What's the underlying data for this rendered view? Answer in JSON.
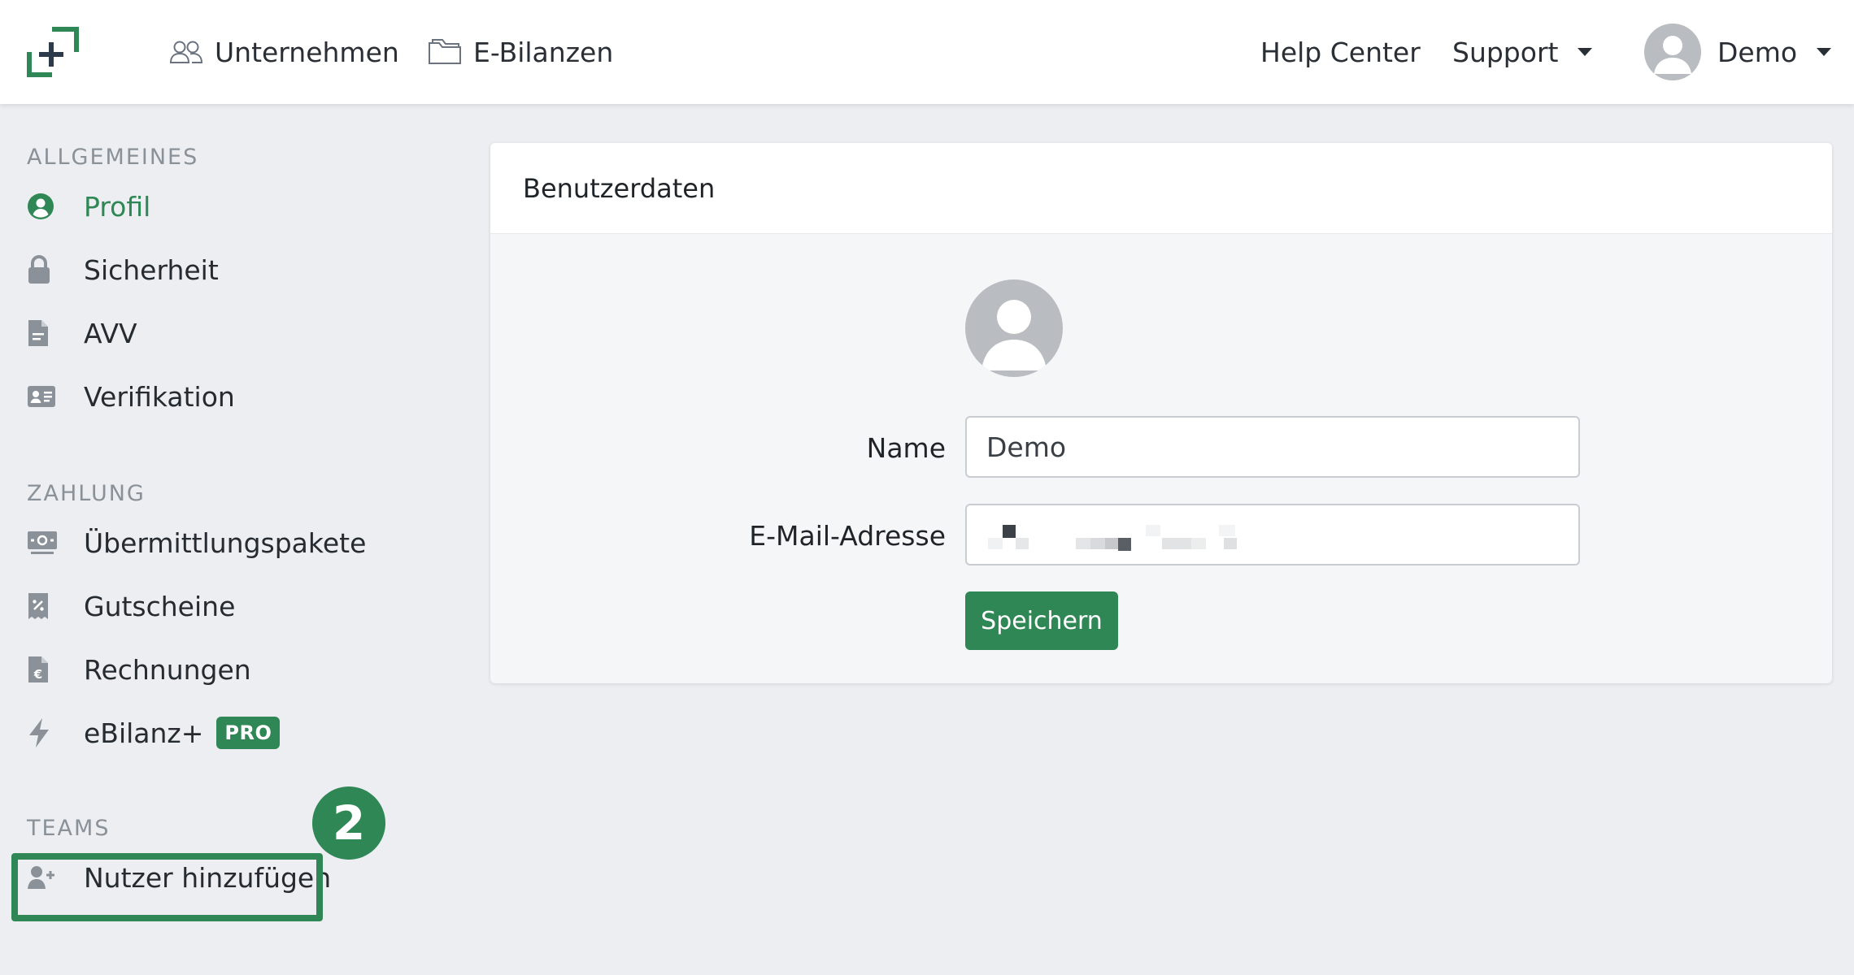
{
  "navbar": {
    "links": {
      "unternehmen": "Unternehmen",
      "ebilanzen": "E-Bilanzen",
      "help_center": "Help Center",
      "support": "Support",
      "user": "Demo"
    }
  },
  "sidebar": {
    "sections": {
      "allgemeines": "ALLGEMEINES",
      "zahlung": "ZAHLUNG",
      "teams": "TEAMS"
    },
    "items": {
      "profil": "Profil",
      "sicherheit": "Sicherheit",
      "avv": "AVV",
      "verifikation": "Verifikation",
      "uebermittlungspakete": "Übermittlungspakete",
      "gutscheine": "Gutscheine",
      "rechnungen": "Rechnungen",
      "ebilanz_plus": "eBilanz+",
      "pro_badge": "PRO",
      "nutzer_hinzufuegen": "Nutzer hinzufügen"
    },
    "active_item": "profil",
    "step_marker": "2"
  },
  "card": {
    "title": "Benutzerdaten",
    "name_label": "Name",
    "name_value": "Demo",
    "email_label": "E-Mail-Adresse",
    "save_button": "Speichern"
  },
  "colors": {
    "accent": "#2e8754",
    "sidebar_icon": "#8a9199",
    "page_bg": "#eceef1"
  }
}
